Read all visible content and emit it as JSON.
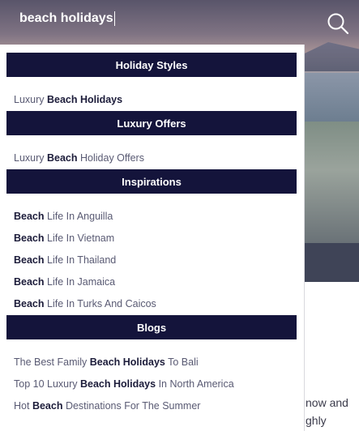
{
  "search": {
    "value": "beach holidays"
  },
  "icons": {
    "search": "search-icon"
  },
  "sections": [
    {
      "header": "Holiday Styles",
      "results": [
        {
          "pre": "Luxury ",
          "bold": "Beach Holidays",
          "post": ""
        }
      ]
    },
    {
      "header": "Luxury Offers",
      "results": [
        {
          "pre": "Luxury ",
          "bold": "Beach",
          "post": " Holiday Offers"
        }
      ]
    },
    {
      "header": "Inspirations",
      "results": [
        {
          "pre": "",
          "bold": "Beach",
          "post": " Life In Anguilla"
        },
        {
          "pre": "",
          "bold": "Beach",
          "post": " Life In Vietnam"
        },
        {
          "pre": "",
          "bold": "Beach",
          "post": " Life In Thailand"
        },
        {
          "pre": "",
          "bold": "Beach",
          "post": " Life In Jamaica"
        },
        {
          "pre": "",
          "bold": "Beach",
          "post": " Life In Turks And Caicos"
        }
      ]
    },
    {
      "header": "Blogs",
      "results": [
        {
          "pre": "The Best Family ",
          "bold": "Beach Holidays",
          "post": " To Bali"
        },
        {
          "pre": "Top 10 Luxury ",
          "bold": "Beach Holidays",
          "post": " In North America"
        },
        {
          "pre": "Hot ",
          "bold": "Beach",
          "post": " Destinations For The Summer"
        }
      ]
    }
  ],
  "background_text": {
    "line1": "now and",
    "line2": "ghly"
  },
  "colors": {
    "header_bg": "#14143b",
    "result_text": "#595a73"
  }
}
